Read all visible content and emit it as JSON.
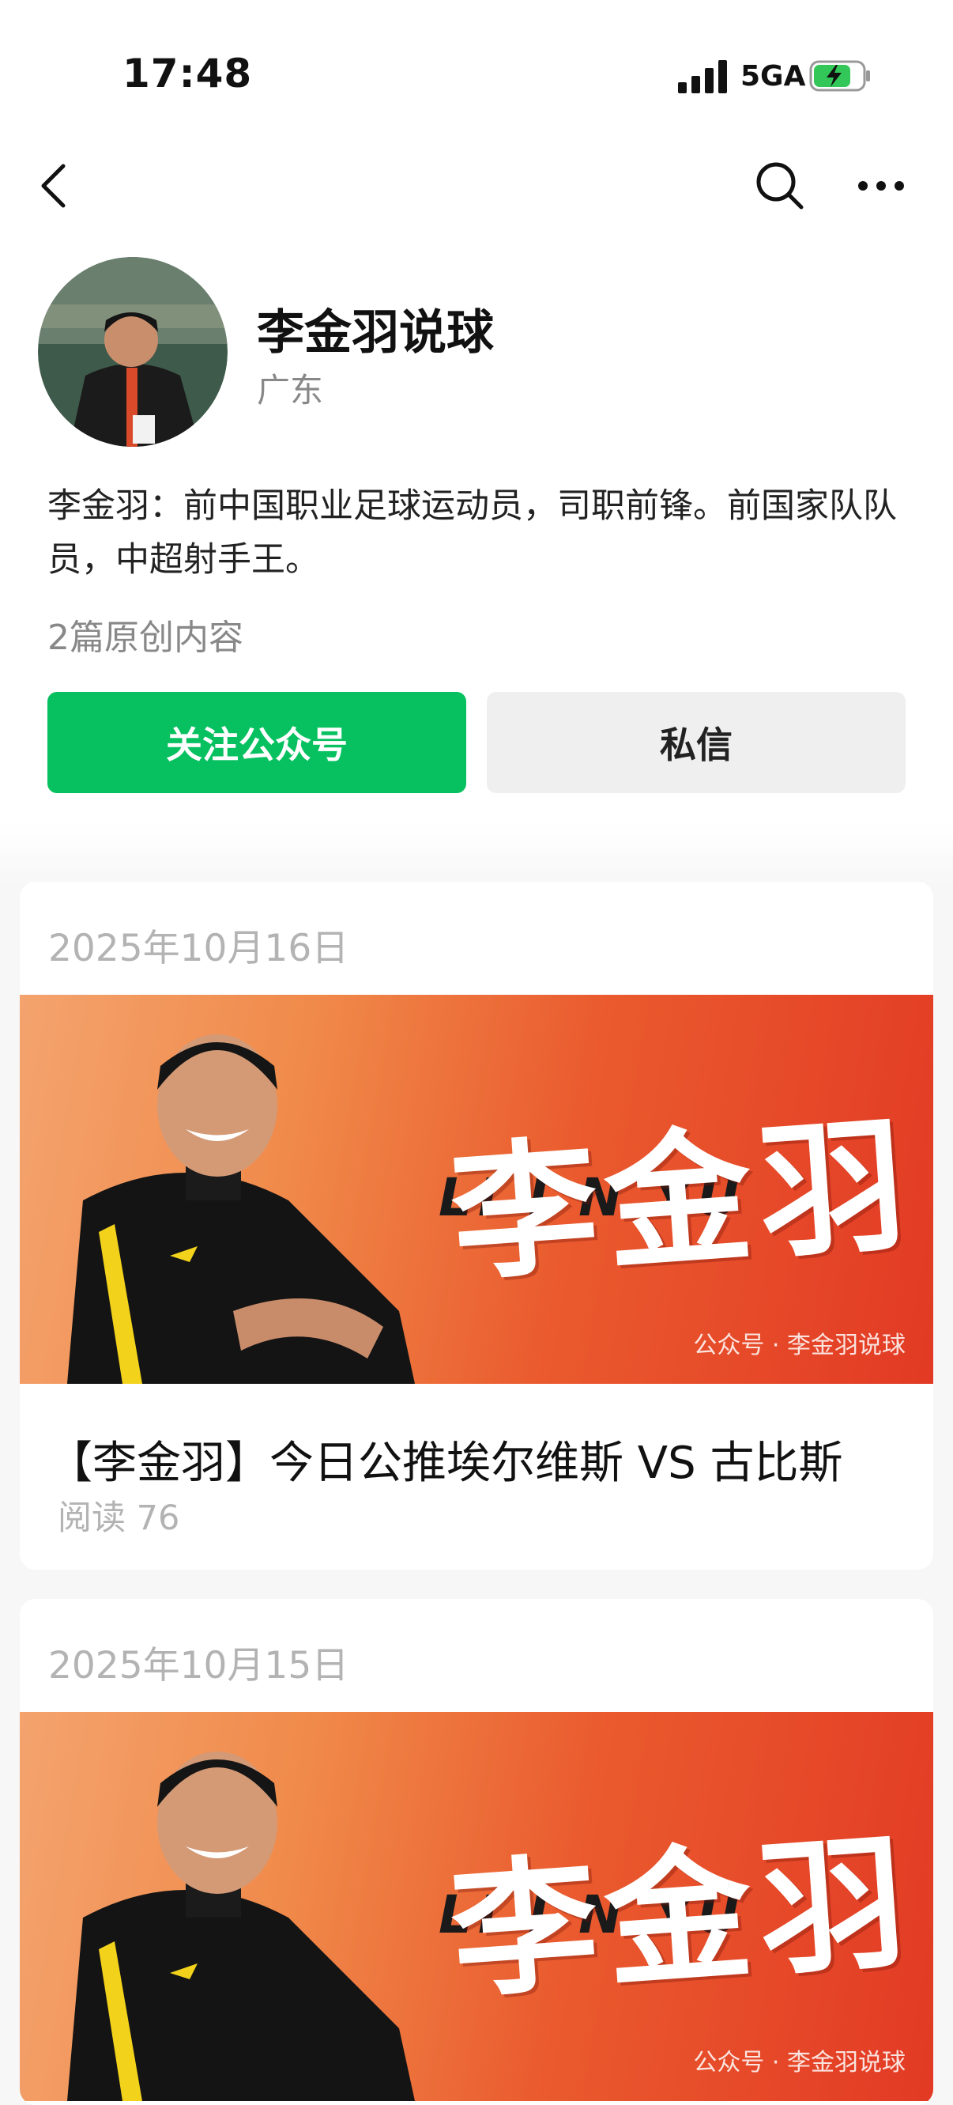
{
  "status_bar": {
    "time": "17:48",
    "network": "5GA"
  },
  "nav": {
    "back_icon": "chevron-left-icon",
    "search_icon": "search-icon",
    "more_icon": "more-icon"
  },
  "profile": {
    "name": "李金羽说球",
    "region": "广东",
    "bio": "李金羽：前中国职业足球运动员，司职前锋。前国家队队员，中超射手王。",
    "original_count": "2篇原创内容",
    "follow_label": "关注公众号",
    "message_label": "私信"
  },
  "articles": [
    {
      "date": "2025年10月16日",
      "title": "【李金羽】今日公推埃尔维斯 VS 古比斯",
      "reads": "阅读 76",
      "cover_hanzi": "李金羽",
      "cover_letters": "LI J N YU",
      "cover_watermark": "公众号 · 李金羽说球"
    },
    {
      "date": "2025年10月15日",
      "cover_hanzi": "李金羽",
      "cover_letters": "LI J N YU",
      "cover_watermark": "公众号 · 李金羽说球"
    }
  ],
  "colors": {
    "accent_green": "#07c160",
    "cover_red": "#e23a24"
  }
}
